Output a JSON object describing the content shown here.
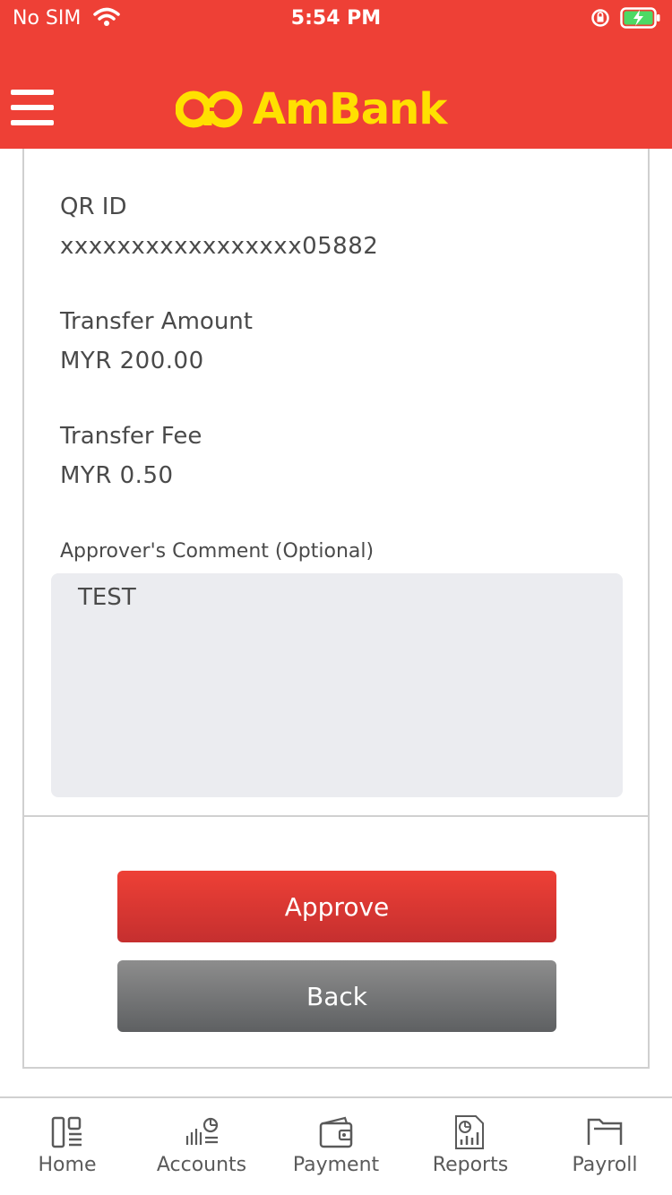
{
  "status_bar": {
    "carrier": "No SIM",
    "time": "5:54 PM"
  },
  "header": {
    "brand": "AmBank"
  },
  "details": {
    "qr_id_label": "QR ID",
    "qr_id_value": "xxxxxxxxxxxxxxxxx05882",
    "amount_label": "Transfer Amount",
    "amount_value": "MYR 200.00",
    "fee_label": "Transfer Fee",
    "fee_value": "MYR 0.50",
    "comment_label": "Approver's Comment (Optional)",
    "comment_value": "TEST"
  },
  "actions": {
    "approve": "Approve",
    "back": "Back"
  },
  "tabs": [
    {
      "label": "Home",
      "icon": "home-icon"
    },
    {
      "label": "Accounts",
      "icon": "accounts-icon"
    },
    {
      "label": "Payment",
      "icon": "wallet-icon"
    },
    {
      "label": "Reports",
      "icon": "reports-icon"
    },
    {
      "label": "Payroll",
      "icon": "folder-icon"
    }
  ],
  "colors": {
    "brand_red": "#ee4036",
    "brand_yellow": "#ffe000",
    "back_gray": "#6e7072"
  }
}
